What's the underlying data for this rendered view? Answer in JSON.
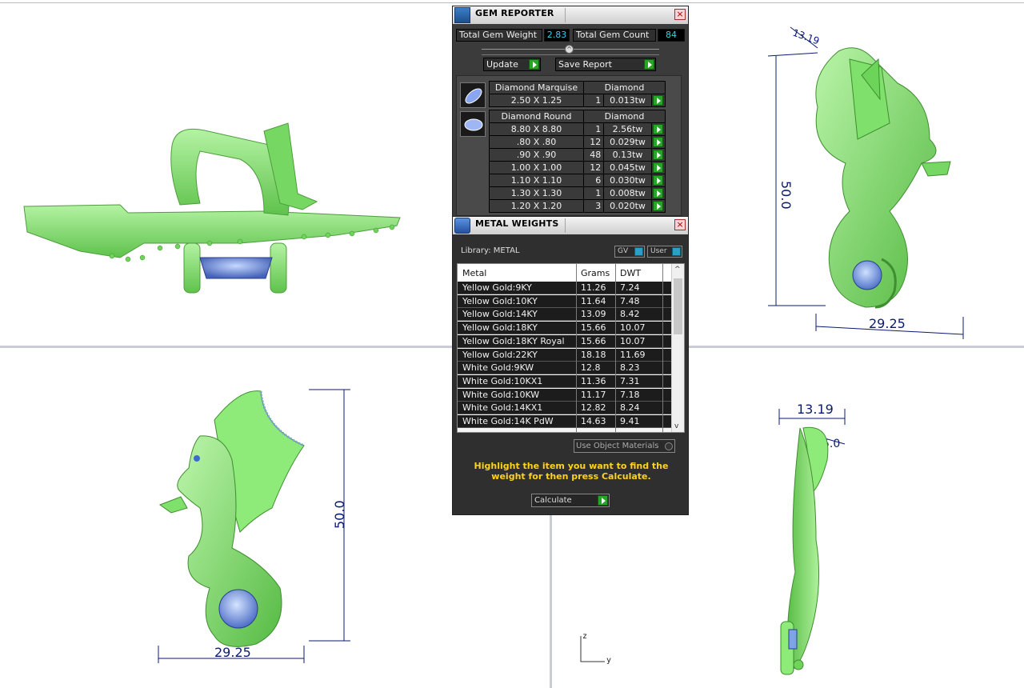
{
  "viewports": {
    "front_left": {},
    "right_top": {
      "dim_top": "13.19",
      "dim_height": "50.0",
      "dim_width": "29.25"
    },
    "front_bottom": {
      "dim_height": "50.0",
      "dim_width": "29.25"
    },
    "side_bottom": {
      "dim_width": "13.19",
      "dim_small": "5.0"
    },
    "axis": {
      "z": "z",
      "y": "y"
    }
  },
  "gem_reporter": {
    "title": "GEM REPORTER",
    "total_weight_label": "Total Gem Weight",
    "total_weight_value": "2.83",
    "total_count_label": "Total Gem Count",
    "total_count_value": "84",
    "update_label": "Update",
    "save_report_label": "Save Report",
    "groups": [
      {
        "shape": "Diamond Marquise",
        "material": "Diamond",
        "icon": "marquise-gem-icon",
        "rows": [
          {
            "size": "2.50 X 1.25",
            "qty": "1",
            "weight": "0.013tw"
          }
        ]
      },
      {
        "shape": "Diamond Round",
        "material": "Diamond",
        "icon": "round-gem-icon",
        "rows": [
          {
            "size": "8.80 X 8.80",
            "qty": "1",
            "weight": "2.56tw"
          },
          {
            "size": ".80 X .80",
            "qty": "12",
            "weight": "0.029tw"
          },
          {
            "size": ".90 X .90",
            "qty": "48",
            "weight": "0.13tw"
          },
          {
            "size": "1.00 X 1.00",
            "qty": "12",
            "weight": "0.045tw"
          },
          {
            "size": "1.10 X 1.10",
            "qty": "6",
            "weight": "0.030tw"
          },
          {
            "size": "1.30 X 1.30",
            "qty": "1",
            "weight": "0.008tw"
          },
          {
            "size": "1.20 X 1.20",
            "qty": "3",
            "weight": "0.020tw"
          }
        ]
      }
    ]
  },
  "metal_weights": {
    "title": "METAL WEIGHTS",
    "library_label": "Library: METAL",
    "gv_label": "GV",
    "user_label": "User",
    "columns": [
      "Metal",
      "Grams",
      "DWT"
    ],
    "rows": [
      [
        "Yellow Gold:9KY",
        "11.26",
        "7.24"
      ],
      [
        "Yellow Gold:10KY",
        "11.64",
        "7.48"
      ],
      [
        "Yellow Gold:14KY",
        "13.09",
        "8.42"
      ],
      [
        "Yellow Gold:18KY",
        "15.66",
        "10.07"
      ],
      [
        "Yellow Gold:18KY Royal",
        "15.66",
        "10.07"
      ],
      [
        "Yellow Gold:22KY",
        "18.18",
        "11.69"
      ],
      [
        "White Gold:9KW",
        "12.8",
        "8.23"
      ],
      [
        "White Gold:10KX1",
        "11.36",
        "7.31"
      ],
      [
        "White Gold:10KW",
        "11.17",
        "7.18"
      ],
      [
        "White Gold:14KX1",
        "12.82",
        "8.24"
      ],
      [
        "White Gold:14K PdW",
        "14.63",
        "9.41"
      ]
    ],
    "use_object_materials_label": "Use Object Materials",
    "hint": "Highlight the item you want to find the weight for then press Calculate.",
    "calculate_label": "Calculate"
  },
  "colors": {
    "model_green": "#8fe87a",
    "gem_blue": "#7ea3e6",
    "dim_navy": "#0a1a72",
    "panel_dark": "#3b3b3b",
    "accent_cyan": "#35d1e6",
    "hint_yellow": "#ffd31a"
  }
}
